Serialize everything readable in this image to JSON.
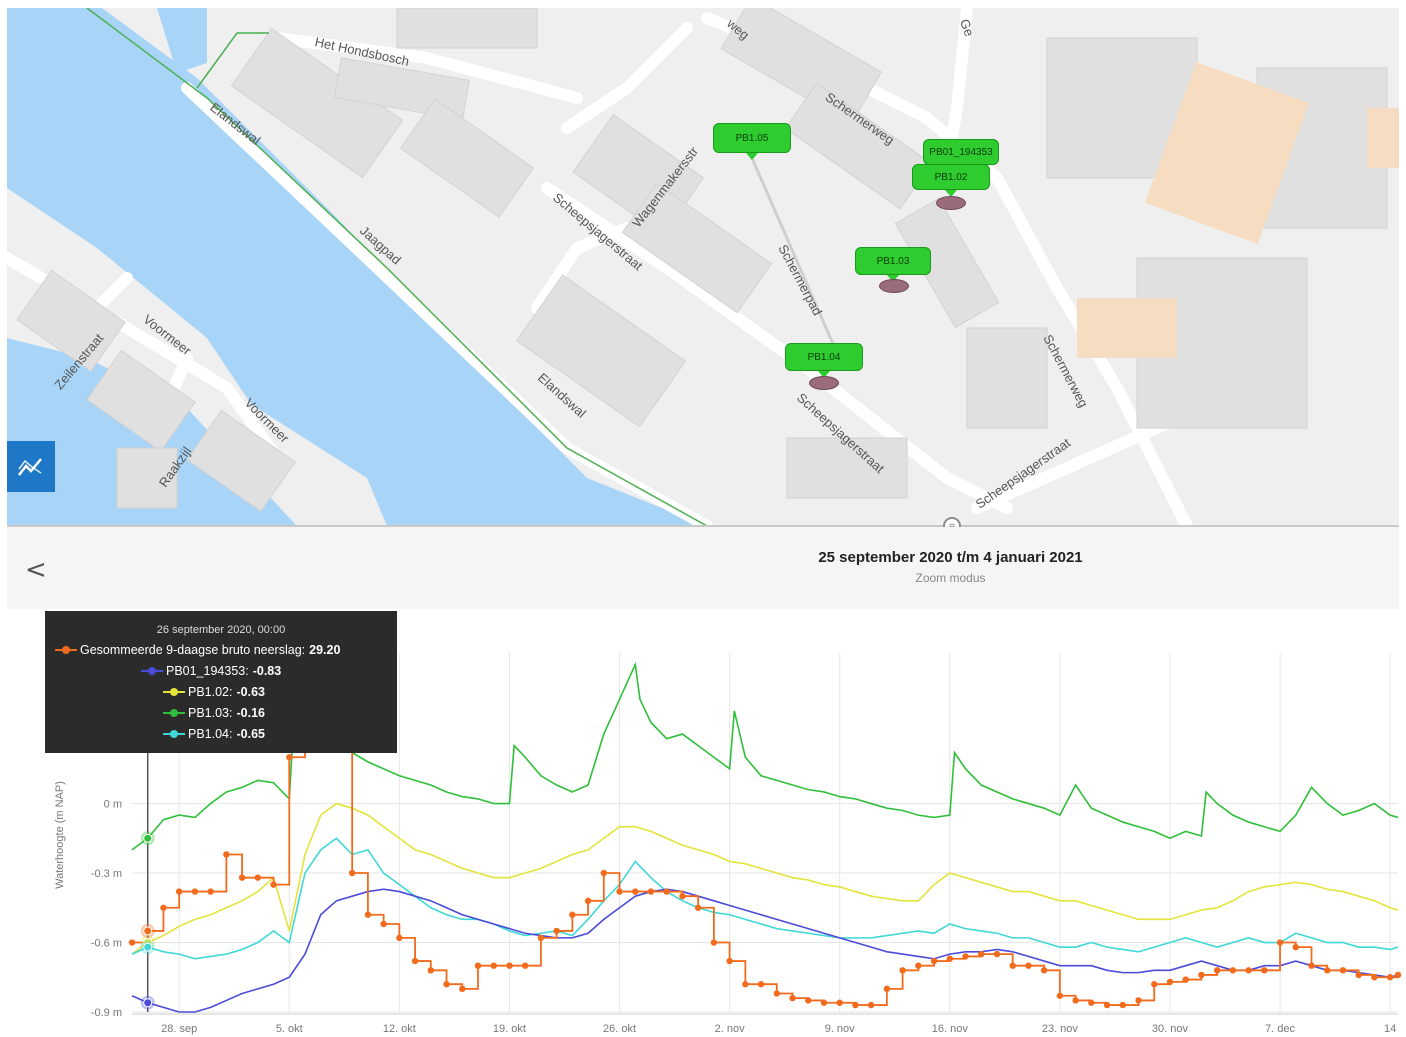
{
  "map": {
    "streets": [
      "Het Hondsbosch",
      "Elandswal",
      "Jaagpad",
      "Elandswal",
      "Scheepsjagerstraat",
      "Wagenmakersstr",
      "Schermerpad",
      "Schermerweg",
      "Scheepsjagerstraat",
      "Schermerweg",
      "Scheepsjagerstraat",
      "Voormeer",
      "Voormeer",
      "Zeilenstraat",
      "Raakzijl",
      "weg",
      "Ge"
    ],
    "markers": [
      {
        "label": "PB1.05"
      },
      {
        "label": "PB01_194353"
      },
      {
        "label": "PB1.02"
      },
      {
        "label": "PB1.03"
      },
      {
        "label": "PB1.04"
      }
    ],
    "graph_button_icon": "line-chart-icon"
  },
  "header": {
    "back_icon": "chevron-left-icon",
    "back_symbol": "<",
    "date_range": "25 september 2020 t/m 4 januari 2021",
    "mode": "Zoom modus",
    "handle_symbol": "="
  },
  "tooltip": {
    "title": "26 september 2020, 00:00",
    "rows": [
      {
        "label": "Gesommeerde 9-daagse bruto neerslag:",
        "value": "29.20",
        "color": "#f26b1d"
      },
      {
        "label": "PB01_194353:",
        "value": "-0.83",
        "color": "#4b4bd9"
      },
      {
        "label": "PB1.02:",
        "value": "-0.63",
        "color": "#e3e33a"
      },
      {
        "label": "PB1.03:",
        "value": "-0.16",
        "color": "#2fbf3a"
      },
      {
        "label": "PB1.04:",
        "value": "-0.65",
        "color": "#3fd7d7"
      }
    ]
  },
  "chart_data": {
    "type": "line",
    "ylabel": "Waterhoogte (m NAP)",
    "y_ticks": [
      "0 m",
      "-0.3 m",
      "-0.6 m",
      "-0.9 m"
    ],
    "y_tick_values": [
      0,
      -0.3,
      -0.6,
      -0.9
    ],
    "ylim": [
      -0.9,
      0.65
    ],
    "x_ticks": [
      "28. sep",
      "5. okt",
      "12. okt",
      "19. okt",
      "26. okt",
      "2. nov",
      "9. nov",
      "16. nov",
      "23. nov",
      "30. nov",
      "7. dec",
      "14"
    ],
    "x_tick_days": [
      3,
      10,
      17,
      24,
      31,
      38,
      45,
      52,
      59,
      66,
      73,
      80
    ],
    "x_unit": "days after 25 september 2020",
    "xlim": [
      0,
      80.5
    ],
    "grid": true,
    "series": [
      {
        "name": "PB1.03",
        "color": "#2fbf3a",
        "x": [
          0,
          1,
          2,
          3,
          4,
          5,
          6,
          7,
          8,
          9,
          10,
          10.5,
          11,
          12,
          13,
          14,
          15,
          16,
          17,
          18,
          19,
          20,
          21,
          22,
          23,
          24,
          24.3,
          25,
          26,
          27,
          28,
          29,
          30,
          31,
          32,
          32.3,
          33,
          34,
          35,
          36,
          37,
          38,
          38.3,
          39,
          40,
          41,
          42,
          43,
          44,
          45,
          46,
          47,
          48,
          49,
          50,
          51,
          52,
          52.3,
          53,
          54,
          55,
          56,
          57,
          58,
          59,
          60,
          61,
          62,
          63,
          64,
          65,
          66,
          67,
          68,
          68.3,
          69,
          70,
          71,
          72,
          73,
          74,
          75,
          76,
          77,
          78,
          79,
          80,
          80.5
        ],
        "y": [
          -0.2,
          -0.15,
          -0.07,
          -0.05,
          -0.06,
          0.0,
          0.05,
          0.07,
          0.1,
          0.09,
          0.02,
          0.6,
          0.5,
          0.42,
          0.3,
          0.22,
          0.18,
          0.15,
          0.12,
          0.1,
          0.08,
          0.05,
          0.03,
          0.02,
          0.0,
          0.0,
          0.25,
          0.2,
          0.12,
          0.08,
          0.05,
          0.08,
          0.3,
          0.45,
          0.6,
          0.45,
          0.35,
          0.28,
          0.3,
          0.25,
          0.2,
          0.15,
          0.4,
          0.2,
          0.12,
          0.1,
          0.08,
          0.06,
          0.05,
          0.03,
          0.02,
          0.0,
          -0.02,
          -0.03,
          -0.05,
          -0.06,
          -0.05,
          0.22,
          0.15,
          0.08,
          0.05,
          0.02,
          0.0,
          -0.02,
          -0.05,
          0.08,
          -0.02,
          -0.05,
          -0.08,
          -0.1,
          -0.12,
          -0.15,
          -0.12,
          -0.14,
          0.05,
          0.0,
          -0.05,
          -0.08,
          -0.1,
          -0.12,
          -0.05,
          0.07,
          0.0,
          -0.05,
          -0.03,
          0.0,
          -0.05,
          -0.06
        ]
      },
      {
        "name": "PB1.02",
        "color": "#e3e33a",
        "x": [
          0,
          1,
          2,
          3,
          4,
          5,
          6,
          7,
          8,
          9,
          10,
          11,
          12,
          13,
          14,
          15,
          16,
          17,
          18,
          19,
          20,
          21,
          22,
          23,
          24,
          25,
          26,
          27,
          28,
          29,
          30,
          31,
          32,
          33,
          34,
          35,
          36,
          37,
          38,
          39,
          40,
          41,
          42,
          43,
          44,
          45,
          46,
          47,
          48,
          49,
          50,
          51,
          52,
          53,
          54,
          55,
          56,
          57,
          58,
          59,
          60,
          61,
          62,
          63,
          64,
          65,
          66,
          67,
          68,
          69,
          70,
          71,
          72,
          73,
          74,
          75,
          76,
          77,
          78,
          79,
          80,
          80.5
        ],
        "y": [
          -0.65,
          -0.6,
          -0.57,
          -0.53,
          -0.5,
          -0.48,
          -0.45,
          -0.42,
          -0.38,
          -0.32,
          -0.55,
          -0.22,
          -0.05,
          0.0,
          -0.02,
          -0.05,
          -0.1,
          -0.15,
          -0.2,
          -0.22,
          -0.25,
          -0.28,
          -0.3,
          -0.32,
          -0.32,
          -0.3,
          -0.28,
          -0.25,
          -0.22,
          -0.2,
          -0.15,
          -0.1,
          -0.1,
          -0.12,
          -0.15,
          -0.18,
          -0.2,
          -0.22,
          -0.25,
          -0.26,
          -0.28,
          -0.3,
          -0.32,
          -0.33,
          -0.35,
          -0.36,
          -0.38,
          -0.4,
          -0.41,
          -0.42,
          -0.42,
          -0.35,
          -0.3,
          -0.32,
          -0.34,
          -0.36,
          -0.38,
          -0.38,
          -0.4,
          -0.42,
          -0.42,
          -0.44,
          -0.46,
          -0.48,
          -0.5,
          -0.5,
          -0.5,
          -0.48,
          -0.46,
          -0.45,
          -0.42,
          -0.38,
          -0.36,
          -0.35,
          -0.34,
          -0.35,
          -0.37,
          -0.38,
          -0.4,
          -0.42,
          -0.45,
          -0.46
        ]
      },
      {
        "name": "PB1.04",
        "color": "#3fd7d7",
        "x": [
          0,
          1,
          2,
          3,
          4,
          5,
          6,
          7,
          8,
          9,
          10,
          11,
          12,
          13,
          14,
          15,
          16,
          17,
          18,
          19,
          20,
          21,
          22,
          23,
          24,
          25,
          26,
          27,
          28,
          29,
          30,
          31,
          32,
          33,
          34,
          35,
          36,
          37,
          38,
          39,
          40,
          41,
          42,
          43,
          44,
          45,
          46,
          47,
          48,
          49,
          50,
          51,
          52,
          53,
          54,
          55,
          56,
          57,
          58,
          59,
          60,
          61,
          62,
          63,
          64,
          65,
          66,
          67,
          68,
          69,
          70,
          71,
          72,
          73,
          74,
          75,
          76,
          77,
          78,
          79,
          80,
          80.5
        ],
        "y": [
          -0.65,
          -0.62,
          -0.64,
          -0.65,
          -0.67,
          -0.66,
          -0.65,
          -0.63,
          -0.6,
          -0.55,
          -0.6,
          -0.3,
          -0.2,
          -0.15,
          -0.22,
          -0.2,
          -0.3,
          -0.35,
          -0.4,
          -0.45,
          -0.48,
          -0.5,
          -0.5,
          -0.52,
          -0.55,
          -0.57,
          -0.56,
          -0.55,
          -0.57,
          -0.5,
          -0.42,
          -0.35,
          -0.25,
          -0.32,
          -0.38,
          -0.42,
          -0.45,
          -0.47,
          -0.48,
          -0.5,
          -0.52,
          -0.54,
          -0.55,
          -0.56,
          -0.57,
          -0.58,
          -0.58,
          -0.58,
          -0.57,
          -0.56,
          -0.55,
          -0.56,
          -0.52,
          -0.54,
          -0.55,
          -0.56,
          -0.58,
          -0.58,
          -0.6,
          -0.62,
          -0.62,
          -0.6,
          -0.62,
          -0.63,
          -0.64,
          -0.62,
          -0.6,
          -0.58,
          -0.6,
          -0.62,
          -0.6,
          -0.58,
          -0.6,
          -0.6,
          -0.56,
          -0.58,
          -0.6,
          -0.6,
          -0.62,
          -0.62,
          -0.63,
          -0.62
        ]
      },
      {
        "name": "PB01_194353",
        "color": "#4b4bd9",
        "x": [
          0,
          1,
          2,
          3,
          4,
          5,
          6,
          7,
          8,
          9,
          10,
          11,
          12,
          13,
          14,
          15,
          16,
          17,
          18,
          19,
          20,
          21,
          22,
          23,
          24,
          25,
          26,
          27,
          28,
          29,
          30,
          31,
          32,
          33,
          34,
          35,
          36,
          37,
          38,
          39,
          40,
          41,
          42,
          43,
          44,
          45,
          46,
          47,
          48,
          49,
          50,
          51,
          52,
          53,
          54,
          55,
          56,
          57,
          58,
          59,
          60,
          61,
          62,
          63,
          64,
          65,
          66,
          67,
          68,
          69,
          70,
          71,
          72,
          73,
          74,
          75,
          76,
          77,
          78,
          79,
          80,
          80.5
        ],
        "y": [
          -0.83,
          -0.86,
          -0.88,
          -0.9,
          -0.9,
          -0.88,
          -0.85,
          -0.82,
          -0.8,
          -0.78,
          -0.75,
          -0.65,
          -0.48,
          -0.42,
          -0.4,
          -0.38,
          -0.37,
          -0.38,
          -0.4,
          -0.42,
          -0.45,
          -0.48,
          -0.5,
          -0.52,
          -0.54,
          -0.56,
          -0.57,
          -0.58,
          -0.58,
          -0.56,
          -0.5,
          -0.45,
          -0.4,
          -0.38,
          -0.37,
          -0.38,
          -0.4,
          -0.42,
          -0.44,
          -0.46,
          -0.48,
          -0.5,
          -0.52,
          -0.54,
          -0.56,
          -0.58,
          -0.6,
          -0.62,
          -0.64,
          -0.65,
          -0.66,
          -0.67,
          -0.65,
          -0.64,
          -0.64,
          -0.63,
          -0.64,
          -0.66,
          -0.68,
          -0.7,
          -0.7,
          -0.7,
          -0.72,
          -0.73,
          -0.73,
          -0.72,
          -0.72,
          -0.7,
          -0.68,
          -0.7,
          -0.72,
          -0.72,
          -0.7,
          -0.7,
          -0.68,
          -0.7,
          -0.72,
          -0.72,
          -0.73,
          -0.74,
          -0.75,
          -0.74
        ]
      },
      {
        "name": "Gesommeerde 9-daagse bruto neerslag",
        "color": "#f26b1d",
        "x": [
          0,
          1,
          2,
          3,
          4,
          5,
          6,
          7,
          8,
          9,
          10,
          11,
          12,
          13,
          14,
          15,
          16,
          17,
          18,
          19,
          20,
          21,
          22,
          23,
          24,
          25,
          26,
          27,
          28,
          29,
          30,
          31,
          32,
          33,
          34,
          35,
          36,
          37,
          38,
          39,
          40,
          41,
          42,
          43,
          44,
          45,
          46,
          47,
          48,
          49,
          50,
          51,
          52,
          53,
          54,
          55,
          56,
          57,
          58,
          59,
          60,
          61,
          62,
          63,
          64,
          65,
          66,
          67,
          68,
          69,
          70,
          71,
          72,
          73,
          74,
          75,
          76,
          77,
          78,
          79,
          80,
          80.5
        ],
        "y": [
          -0.6,
          -0.55,
          -0.45,
          -0.38,
          -0.38,
          -0.38,
          -0.22,
          -0.32,
          -0.32,
          -0.35,
          0.2,
          0.4,
          0.5,
          0.35,
          -0.3,
          -0.48,
          -0.52,
          -0.58,
          -0.68,
          -0.72,
          -0.78,
          -0.8,
          -0.7,
          -0.7,
          -0.7,
          -0.7,
          -0.58,
          -0.55,
          -0.48,
          -0.42,
          -0.3,
          -0.38,
          -0.38,
          -0.38,
          -0.38,
          -0.4,
          -0.45,
          -0.6,
          -0.68,
          -0.78,
          -0.78,
          -0.82,
          -0.84,
          -0.85,
          -0.86,
          -0.86,
          -0.87,
          -0.87,
          -0.8,
          -0.72,
          -0.7,
          -0.68,
          -0.67,
          -0.66,
          -0.65,
          -0.65,
          -0.7,
          -0.7,
          -0.72,
          -0.83,
          -0.85,
          -0.86,
          -0.87,
          -0.87,
          -0.85,
          -0.78,
          -0.77,
          -0.76,
          -0.74,
          -0.72,
          -0.72,
          -0.72,
          -0.72,
          -0.6,
          -0.62,
          -0.7,
          -0.72,
          -0.72,
          -0.74,
          -0.75,
          -0.75,
          -0.74
        ]
      }
    ],
    "crosshair_day": 1
  }
}
